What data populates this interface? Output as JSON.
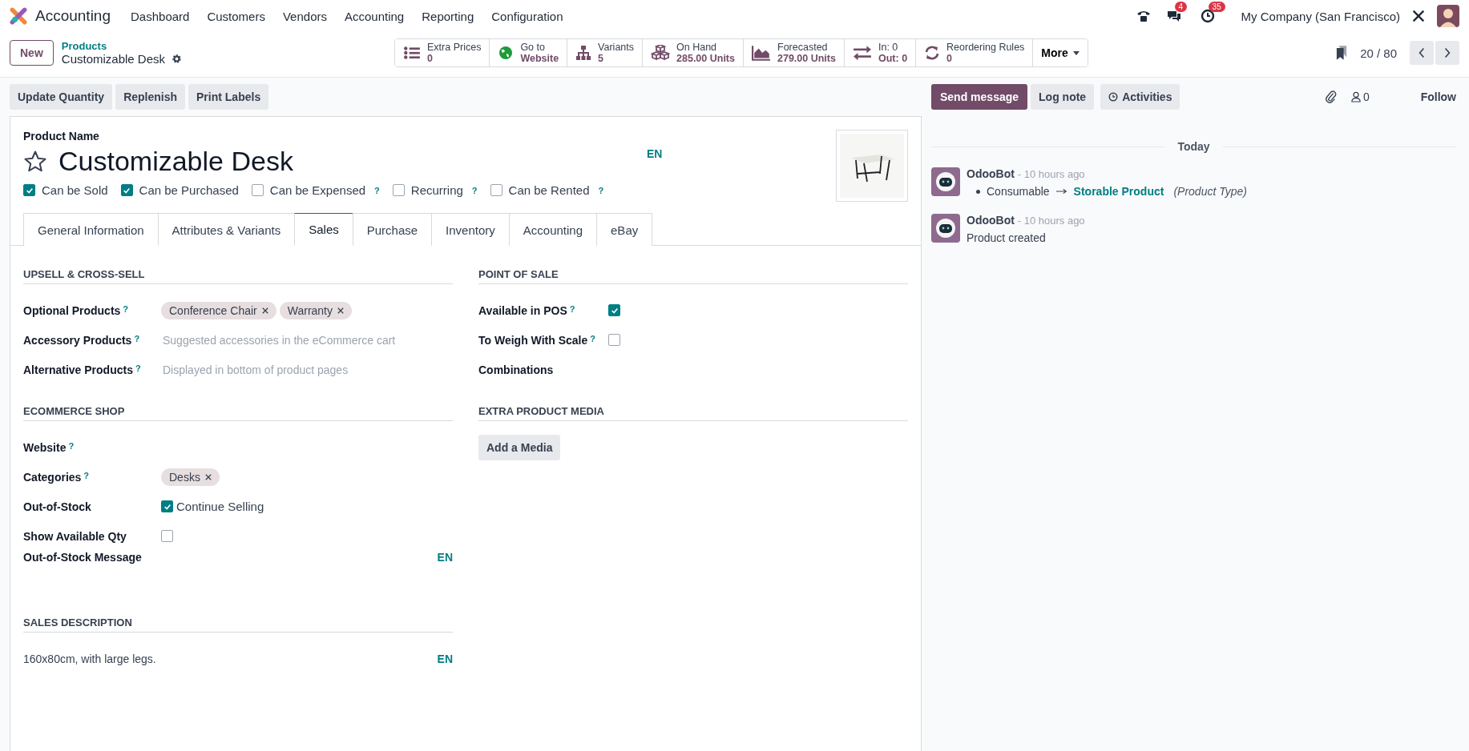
{
  "navbar": {
    "app_name": "Accounting",
    "menu": [
      "Dashboard",
      "Customers",
      "Vendors",
      "Accounting",
      "Reporting",
      "Configuration"
    ],
    "messages_badge": "4",
    "activities_badge": "35",
    "company": "My Company (San Francisco)"
  },
  "control_panel": {
    "new_button": "New",
    "breadcrumb_parent": "Products",
    "breadcrumb_current": "Customizable Desk",
    "smart_buttons": [
      {
        "kind": "list",
        "line1": "Extra Prices",
        "line2": "0"
      },
      {
        "kind": "globe",
        "line1": "Go to",
        "line2": "Website"
      },
      {
        "kind": "hierarchy",
        "line1": "Variants",
        "line2": "5"
      },
      {
        "kind": "cubes",
        "line1": "On Hand",
        "line2": "285.00 Units"
      },
      {
        "kind": "area",
        "line1": "Forecasted",
        "line2": "279.00 Units"
      },
      {
        "kind": "exchange",
        "line1": "In: 0",
        "line2": "Out: 0"
      },
      {
        "kind": "refresh",
        "line1": "Reordering Rules",
        "line2": "0"
      }
    ],
    "more_button": "More",
    "pager": "20 / 80"
  },
  "actions": [
    "Update Quantity",
    "Replenish",
    "Print Labels"
  ],
  "form": {
    "name_label": "Product Name",
    "name": "Customizable Desk",
    "starred": false,
    "lang": "EN",
    "options": [
      {
        "label": "Can be Sold",
        "checked": true
      },
      {
        "label": "Can be Purchased",
        "checked": true
      },
      {
        "label": "Can be Expensed",
        "checked": false,
        "help": "?"
      },
      {
        "label": "Recurring",
        "checked": false,
        "help": "?"
      },
      {
        "label": "Can be Rented",
        "checked": false,
        "help": "?"
      }
    ],
    "tabs": [
      {
        "label": "General Information",
        "selected": false
      },
      {
        "label": "Attributes & Variants",
        "selected": false
      },
      {
        "label": "Sales",
        "selected": true
      },
      {
        "label": "Purchase",
        "selected": false
      },
      {
        "label": "Inventory",
        "selected": false
      },
      {
        "label": "Accounting",
        "selected": false
      },
      {
        "label": "eBay",
        "selected": false
      }
    ],
    "columns": [
      [
        {
          "title": "UPSELL & CROSS-SELL",
          "fields": [
            {
              "kind": "tags",
              "label": "Optional Products",
              "help": "?",
              "tags": [
                "Conference Chair",
                "Warranty"
              ]
            },
            {
              "kind": "placeholder",
              "label": "Accessory Products",
              "help": "?",
              "placeholder": "Suggested accessories in the eCommerce cart"
            },
            {
              "kind": "placeholder",
              "label": "Alternative Products",
              "help": "?",
              "placeholder": "Displayed in bottom of product pages"
            }
          ]
        },
        {
          "title": "ECOMMERCE SHOP",
          "fields": [
            {
              "kind": "empty",
              "label": "Website",
              "help": "?"
            },
            {
              "kind": "tags",
              "label": "Categories",
              "help": "?",
              "tags": [
                "Desks"
              ]
            },
            {
              "kind": "checkbox",
              "label": "Out-of-Stock",
              "checked": true,
              "text": "Continue Selling"
            },
            {
              "kind": "checkbox",
              "label": "Show Available Qty",
              "checked": false
            },
            {
              "kind": "lang",
              "label": "Out-of-Stock Message",
              "lang": "EN"
            }
          ]
        },
        {
          "title": "SALES DESCRIPTION",
          "fields": [
            {
              "kind": "text",
              "text": "160x80cm, with large legs.",
              "lang": "EN"
            }
          ]
        }
      ],
      [
        {
          "title": "POINT OF SALE",
          "fields": [
            {
              "kind": "checkbox",
              "label": "Available in POS",
              "help": "?",
              "checked": true
            },
            {
              "kind": "checkbox",
              "label": "To Weigh With Scale",
              "help": "?",
              "checked": false
            },
            {
              "kind": "empty",
              "label": "Combinations"
            }
          ]
        },
        {
          "title": "EXTRA PRODUCT MEDIA",
          "fields": [
            {
              "kind": "button",
              "text": "Add a Media"
            }
          ]
        }
      ]
    ]
  },
  "chatter": {
    "send_message": "Send message",
    "log_note": "Log note",
    "activities": "Activities",
    "followers": "0",
    "follow": "Follow",
    "date": "Today",
    "messages": [
      {
        "author": "OdooBot",
        "time": "- 10 hours ago",
        "kind": "tracking",
        "old": "Consumable",
        "new": "Storable Product",
        "field": "(Product Type)"
      },
      {
        "author": "OdooBot",
        "time": "- 10 hours ago",
        "kind": "text",
        "text": "Product created"
      }
    ]
  }
}
